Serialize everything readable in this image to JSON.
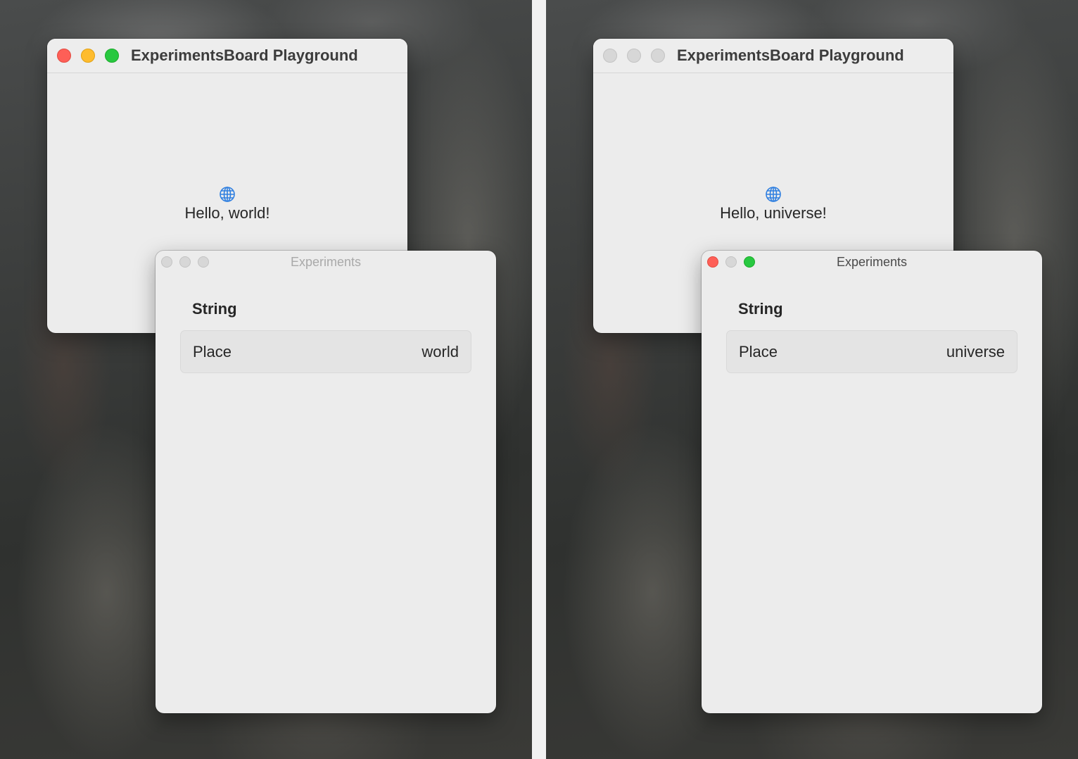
{
  "left": {
    "main_window": {
      "title": "ExperimentsBoard Playground",
      "greeting": "Hello, world!",
      "icon": "globe-icon",
      "active": true
    },
    "experiments_window": {
      "title": "Experiments",
      "section": "String",
      "field_label": "Place",
      "field_value": "world",
      "active": false
    }
  },
  "right": {
    "main_window": {
      "title": "ExperimentsBoard Playground",
      "greeting": "Hello, universe!",
      "icon": "globe-icon",
      "active": false
    },
    "experiments_window": {
      "title": "Experiments",
      "section": "String",
      "field_label": "Place",
      "field_value": "universe",
      "active": true
    }
  },
  "colors": {
    "close": "#fe5f57",
    "minimize": "#febc2e",
    "zoom": "#28c840",
    "inactive_light": "#d7d7d7",
    "globe": "#2f7fe0"
  }
}
